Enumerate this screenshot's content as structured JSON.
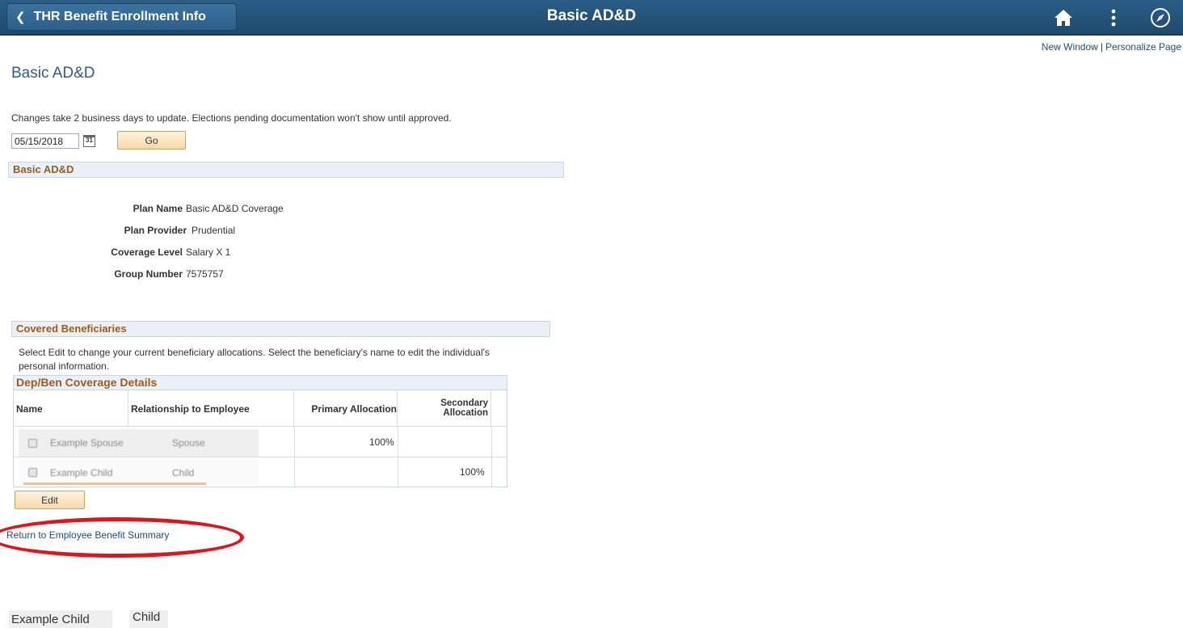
{
  "banner": {
    "back_label": "THR Benefit Enrollment Info",
    "title": "Basic AD&D",
    "icons": [
      "chevron-left-icon",
      "home-icon",
      "more-vertical-icon",
      "compass-icon"
    ]
  },
  "top_links": {
    "new_window": "New Window",
    "separator": "|",
    "personalize": "Personalize Page"
  },
  "page": {
    "title": "Basic AD&D",
    "info": "Changes take 2 business days to update. Elections pending documentation won't show until approved.",
    "date_value": "05/15/2018",
    "calendar_label": "31",
    "go_label": "Go"
  },
  "plan_section": {
    "header": "Basic AD&D",
    "rows": [
      {
        "label": "Plan Name",
        "value": "Basic AD&D Coverage"
      },
      {
        "label": "Plan Provider",
        "value": "Prudential"
      },
      {
        "label": "Coverage Level",
        "value": "Salary X 1"
      },
      {
        "label": "Group Number",
        "value": "7575757"
      }
    ]
  },
  "beneficiaries": {
    "header": "Covered Beneficiaries",
    "instructions": "Select Edit to change your current beneficiary allocations. Select the beneficiary's name to edit the individual's personal information.",
    "grid_title": "Dep/Ben Coverage Details",
    "columns": [
      "Name",
      "Relationship to Employee",
      "Primary Allocation",
      "Secondary Allocation"
    ],
    "rows": [
      {
        "name": "Example Spouse",
        "relationship": "Spouse",
        "primary": "100%",
        "secondary": ""
      },
      {
        "name": "Example Child",
        "relationship": "Child",
        "primary": "",
        "secondary": "100%"
      }
    ],
    "edit_label": "Edit"
  },
  "return_link": "Return to Employee Benefit Summary",
  "bottom_row": {
    "name": "Example Child",
    "relationship": "Child"
  },
  "colors": {
    "banner": "#1f4a6e",
    "link": "#1b4f7d",
    "section_header_text": "#9e5a1a",
    "button": "#f7d9a8",
    "highlight_oval": "#e0141b"
  }
}
